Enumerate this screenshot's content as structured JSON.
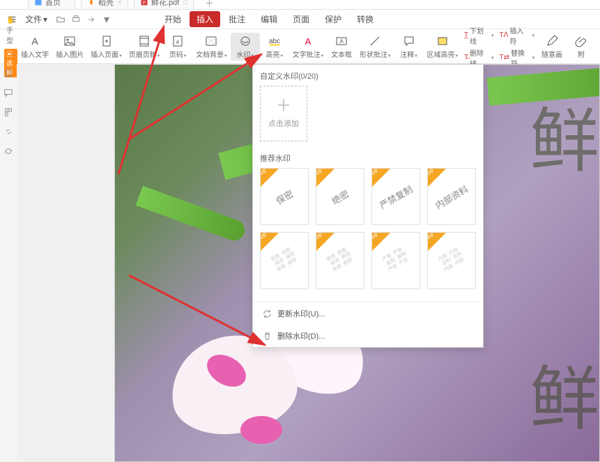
{
  "tabs": {
    "home": "首页",
    "doc1": "稻壳",
    "doc2": "鲜花.pdf"
  },
  "file_menu": "文件",
  "menu": {
    "start": "开始",
    "insert": "插入",
    "annotate": "批注",
    "edit": "编辑",
    "page": "页面",
    "protect": "保护",
    "convert": "转换"
  },
  "ribbon": {
    "hand": "手型",
    "select": "选择",
    "insert_text": "插入文字",
    "insert_image": "插入图片",
    "insert_page": "插入页面",
    "header_footer": "页眉页脚",
    "page_no": "页码",
    "doc_bg": "文档背景",
    "watermark": "水印",
    "highlight": "高亮",
    "text_annot": "文字批注",
    "textbox": "文本框",
    "shape_annot": "形状批注",
    "notes": "注释",
    "area_hl": "区域高亮",
    "underline": "下划线",
    "insert_symbol": "插入符",
    "strike": "删除线",
    "replace_sym": "替换符",
    "freehand": "随意画",
    "attach": "附"
  },
  "popup": {
    "custom_title": "自定义水印(0/20)",
    "add": "点击添加",
    "reco_title": "推荐水印",
    "wm1": "保密",
    "wm2": "绝密",
    "wm3": "严禁复制",
    "wm4": "内部资料",
    "wm_pat1": "保密  保密\n  保密  保密\n保密  保密",
    "wm_pat2": "绝密  绝密\n  绝密  绝密\n绝密  绝密",
    "wm_pat3": "严禁  严禁\n  复制  复制\n严禁  严禁",
    "wm_pat4": "内部  内部\n  资料  资料\n内部  内部",
    "update": "更新水印(U)...",
    "delete": "删除水印(D)..."
  },
  "wm_preview": "鲜",
  "colors": {
    "accent": "#c92a2a",
    "orange": "#ff8c1a",
    "vip": "#f5a623"
  }
}
